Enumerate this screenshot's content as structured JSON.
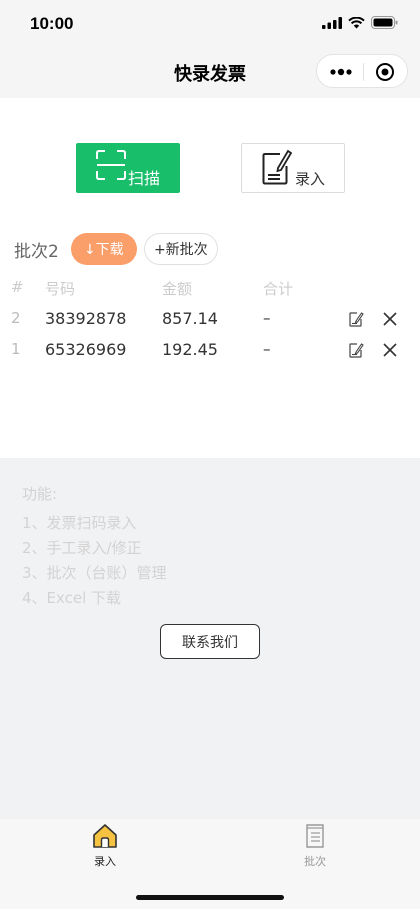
{
  "statusbar": {
    "time": "10:00"
  },
  "navbar": {
    "title": "快录发票"
  },
  "actions": {
    "scan_label": "扫描",
    "input_label": "录入"
  },
  "batch": {
    "name": "批次2",
    "download_label": "↓下载",
    "new_batch_label": "+新批次"
  },
  "table": {
    "headers": {
      "idx": "#",
      "number": "号码",
      "amount": "金额",
      "total": "合计"
    },
    "rows": [
      {
        "idx": "2",
        "number": "38392878",
        "amount": "857.14",
        "total": "–"
      },
      {
        "idx": "1",
        "number": "65326969",
        "amount": "192.45",
        "total": "–"
      }
    ]
  },
  "info": {
    "title": "功能:",
    "items": [
      "1、发票扫码录入",
      "2、手工录入/修正",
      "3、批次（台账）管理",
      "4、Excel 下载"
    ],
    "contact_label": "联系我们"
  },
  "tabbar": {
    "tabs": [
      {
        "label": "录入",
        "active": true
      },
      {
        "label": "批次",
        "active": false
      }
    ]
  },
  "colors": {
    "scan_green": "#19be6b",
    "download_orange": "#fa9e6a",
    "active_tab": "#f5c242"
  }
}
